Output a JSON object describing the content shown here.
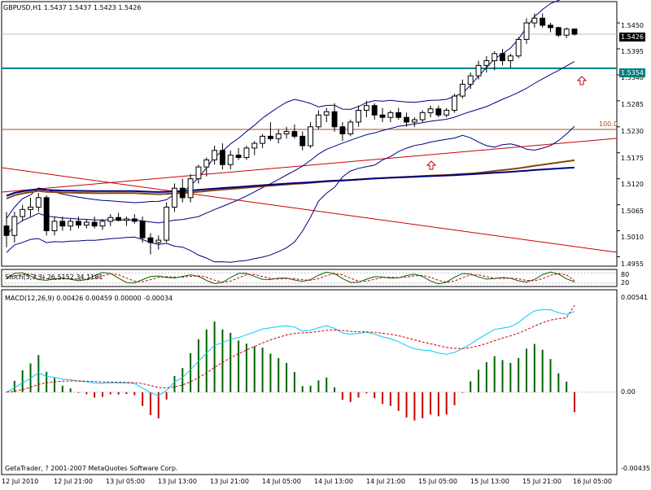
{
  "header": {
    "symbol": "GBPUSD,H1",
    "ohlc": "1.5437 1.5437 1.5423 1.5426"
  },
  "price_axis": {
    "ticks": [
      "1.5450",
      "1.5395",
      "1.5340",
      "1.5285",
      "1.5230",
      "1.5175",
      "1.5120",
      "1.5065",
      "1.5010",
      "1.4955"
    ],
    "current_price": "1.5426",
    "hline_price": "1.5354",
    "fib_level": "100.0"
  },
  "stoch": {
    "label": "Stoch(5,3,3) 26.5152 34.1181",
    "levels": [
      "80",
      "20"
    ]
  },
  "macd": {
    "label": "MACD(12,26,9) 0.00426 0.00459 0.00000 -0.00034",
    "ticks": [
      "0.00541",
      "0.00",
      "-0.00435"
    ]
  },
  "footer": {
    "copyright": "GetaTrader, ? 2001-2007 MetaQuotes Software Corp."
  },
  "time_axis": [
    "12 Jul 2010",
    "12 Jul 21:00",
    "13 Jul 05:00",
    "13 Jul 13:00",
    "13 Jul 21:00",
    "14 Jul 05:00",
    "14 Jul 13:00",
    "14 Jul 21:00",
    "15 Jul 05:00",
    "15 Jul 13:00",
    "15 Jul 21:00",
    "16 Jul 05:00"
  ],
  "colors": {
    "bull": "#ffffff",
    "bear": "#000000",
    "bollinger": "#000080",
    "ma_brown": "#8b4513",
    "ma_blue": "#000080",
    "trend_red": "#cc0000",
    "hline_teal": "#008080",
    "fib_line": "#a0522d",
    "macd_main": "#00ccff",
    "macd_signal": "#cc0000",
    "hist_pos": "#006400",
    "hist_neg": "#cc0000"
  },
  "chart_data": [
    {
      "type": "candlestick",
      "symbol": "GBPUSD,H1",
      "y_range": [
        1.4935,
        1.5495
      ],
      "candles": [
        [
          1.502,
          1.505,
          1.4975,
          1.5
        ],
        [
          1.5,
          1.505,
          1.4985,
          1.504
        ],
        [
          1.504,
          1.5065,
          1.503,
          1.5055
        ],
        [
          1.5055,
          1.508,
          1.504,
          1.506
        ],
        [
          1.506,
          1.509,
          1.505,
          1.508
        ],
        [
          1.508,
          1.5085,
          1.5,
          1.501
        ],
        [
          1.501,
          1.504,
          1.5,
          1.503
        ],
        [
          1.503,
          1.504,
          1.501,
          1.502
        ],
        [
          1.502,
          1.5035,
          1.501,
          1.503
        ],
        [
          1.503,
          1.504,
          1.5015,
          1.5022
        ],
        [
          1.5022,
          1.5035,
          1.5015,
          1.5028
        ],
        [
          1.5028,
          1.504,
          1.5015,
          1.502
        ],
        [
          1.502,
          1.5035,
          1.5012,
          1.503
        ],
        [
          1.503,
          1.5045,
          1.502,
          1.5038
        ],
        [
          1.5038,
          1.5048,
          1.503,
          1.5032
        ],
        [
          1.5032,
          1.504,
          1.502,
          1.5035
        ],
        [
          1.5035,
          1.5045,
          1.5025,
          1.503
        ],
        [
          1.503,
          1.504,
          1.4985,
          1.4995
        ],
        [
          1.4995,
          1.5005,
          1.496,
          1.4985
        ],
        [
          1.4985,
          1.5,
          1.497,
          1.499
        ],
        [
          1.499,
          1.507,
          1.4985,
          1.506
        ],
        [
          1.506,
          1.511,
          1.505,
          1.51
        ],
        [
          1.51,
          1.512,
          1.507,
          1.508
        ],
        [
          1.508,
          1.513,
          1.507,
          1.512
        ],
        [
          1.512,
          1.515,
          1.511,
          1.5145
        ],
        [
          1.5145,
          1.5165,
          1.5125,
          1.516
        ],
        [
          1.516,
          1.519,
          1.515,
          1.518
        ],
        [
          1.518,
          1.5195,
          1.514,
          1.515
        ],
        [
          1.515,
          1.518,
          1.514,
          1.517
        ],
        [
          1.517,
          1.5185,
          1.516,
          1.5165
        ],
        [
          1.5165,
          1.519,
          1.516,
          1.5185
        ],
        [
          1.5185,
          1.52,
          1.517,
          1.5195
        ],
        [
          1.5195,
          1.5215,
          1.5185,
          1.521
        ],
        [
          1.521,
          1.524,
          1.52,
          1.5205
        ],
        [
          1.5205,
          1.5225,
          1.5195,
          1.5215
        ],
        [
          1.5215,
          1.523,
          1.5205,
          1.522
        ],
        [
          1.522,
          1.5235,
          1.5205,
          1.521
        ],
        [
          1.521,
          1.522,
          1.518,
          1.519
        ],
        [
          1.519,
          1.524,
          1.5185,
          1.523
        ],
        [
          1.523,
          1.5265,
          1.5225,
          1.5255
        ],
        [
          1.5255,
          1.527,
          1.524,
          1.5262
        ],
        [
          1.5262,
          1.528,
          1.522,
          1.523
        ],
        [
          1.523,
          1.524,
          1.52,
          1.5215
        ],
        [
          1.5215,
          1.5245,
          1.521,
          1.524
        ],
        [
          1.524,
          1.5275,
          1.523,
          1.5265
        ],
        [
          1.5265,
          1.5285,
          1.525,
          1.5275
        ],
        [
          1.5275,
          1.528,
          1.5245,
          1.5255
        ],
        [
          1.5255,
          1.527,
          1.524,
          1.525
        ],
        [
          1.525,
          1.5265,
          1.524,
          1.526
        ],
        [
          1.526,
          1.527,
          1.5245,
          1.525
        ],
        [
          1.525,
          1.526,
          1.523,
          1.524
        ],
        [
          1.524,
          1.525,
          1.523,
          1.5245
        ],
        [
          1.5245,
          1.5265,
          1.524,
          1.526
        ],
        [
          1.526,
          1.5275,
          1.525,
          1.5268
        ],
        [
          1.5268,
          1.5275,
          1.525,
          1.5255
        ],
        [
          1.5255,
          1.527,
          1.525,
          1.5265
        ],
        [
          1.5265,
          1.53,
          1.526,
          1.5295
        ],
        [
          1.5295,
          1.533,
          1.529,
          1.532
        ],
        [
          1.532,
          1.5345,
          1.531,
          1.5338
        ],
        [
          1.5338,
          1.537,
          1.533,
          1.536
        ],
        [
          1.536,
          1.538,
          1.5345,
          1.537
        ],
        [
          1.537,
          1.539,
          1.535,
          1.5385
        ],
        [
          1.5385,
          1.5395,
          1.536,
          1.537
        ],
        [
          1.537,
          1.5385,
          1.5355,
          1.538
        ],
        [
          1.538,
          1.542,
          1.5375,
          1.5415
        ],
        [
          1.5415,
          1.546,
          1.5405,
          1.545
        ],
        [
          1.545,
          1.547,
          1.544,
          1.546
        ],
        [
          1.546,
          1.547,
          1.544,
          1.5445
        ],
        [
          1.5445,
          1.545,
          1.543,
          1.544
        ],
        [
          1.544,
          1.5442,
          1.542,
          1.5424
        ],
        [
          1.5424,
          1.544,
          1.5418,
          1.5437
        ],
        [
          1.5437,
          1.5437,
          1.5423,
          1.5426
        ]
      ]
    },
    {
      "type": "line",
      "name": "Stoch(5,3,3)",
      "y_range": [
        0,
        100
      ],
      "main_last": 26.5152,
      "signal_last": 34.1181
    },
    {
      "type": "line+bar",
      "name": "MACD(12,26,9)",
      "y_range": [
        -0.00435,
        0.00541
      ],
      "main_last": 0.00426,
      "signal_last": 0.00459
    }
  ]
}
